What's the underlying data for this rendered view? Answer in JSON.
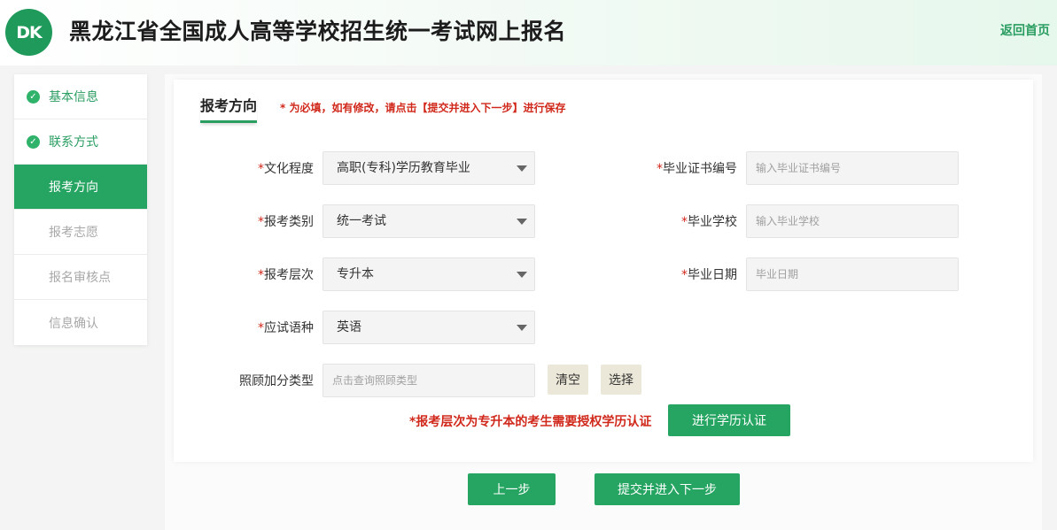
{
  "header": {
    "logo_text": "DK",
    "title": "黑龙江省全国成人高等学校招生统一考试网上报名",
    "back_home": "返回首页"
  },
  "sidebar": {
    "items": [
      {
        "label": "基本信息",
        "state": "done"
      },
      {
        "label": "联系方式",
        "state": "done"
      },
      {
        "label": "报考方向",
        "state": "active"
      },
      {
        "label": "报考志愿",
        "state": "pending"
      },
      {
        "label": "报名审核点",
        "state": "pending"
      },
      {
        "label": "信息确认",
        "state": "pending"
      }
    ]
  },
  "form": {
    "section_title": "报考方向",
    "required_note": "* 为必填，如有修改，请点击【提交并进入下一步】进行保存",
    "required_mark": "*",
    "education_level": {
      "label": "文化程度",
      "value": "高职(专科)学历教育毕业"
    },
    "exam_category": {
      "label": "报考类别",
      "value": "统一考试"
    },
    "exam_level": {
      "label": "报考层次",
      "value": "专升本"
    },
    "exam_language": {
      "label": "应试语种",
      "value": "英语"
    },
    "bonus_type": {
      "label": "照顾加分类型",
      "placeholder": "点击查询照顾类型",
      "clear_label": "清空",
      "select_label": "选择"
    },
    "certificate_no": {
      "label": "毕业证书编号",
      "placeholder": "输入毕业证书编号"
    },
    "graduation_school": {
      "label": "毕业学校",
      "placeholder": "输入毕业学校"
    },
    "graduation_date": {
      "label": "毕业日期",
      "placeholder": "毕业日期"
    },
    "auth_note": "*报考层次为专升本的考生需要授权学历认证",
    "auth_button": "进行学历认证"
  },
  "footer": {
    "prev_button": "上一步",
    "next_button": "提交并进入下一步"
  },
  "colors": {
    "brand_green": "#26a562",
    "required_red": "#d0281b"
  }
}
